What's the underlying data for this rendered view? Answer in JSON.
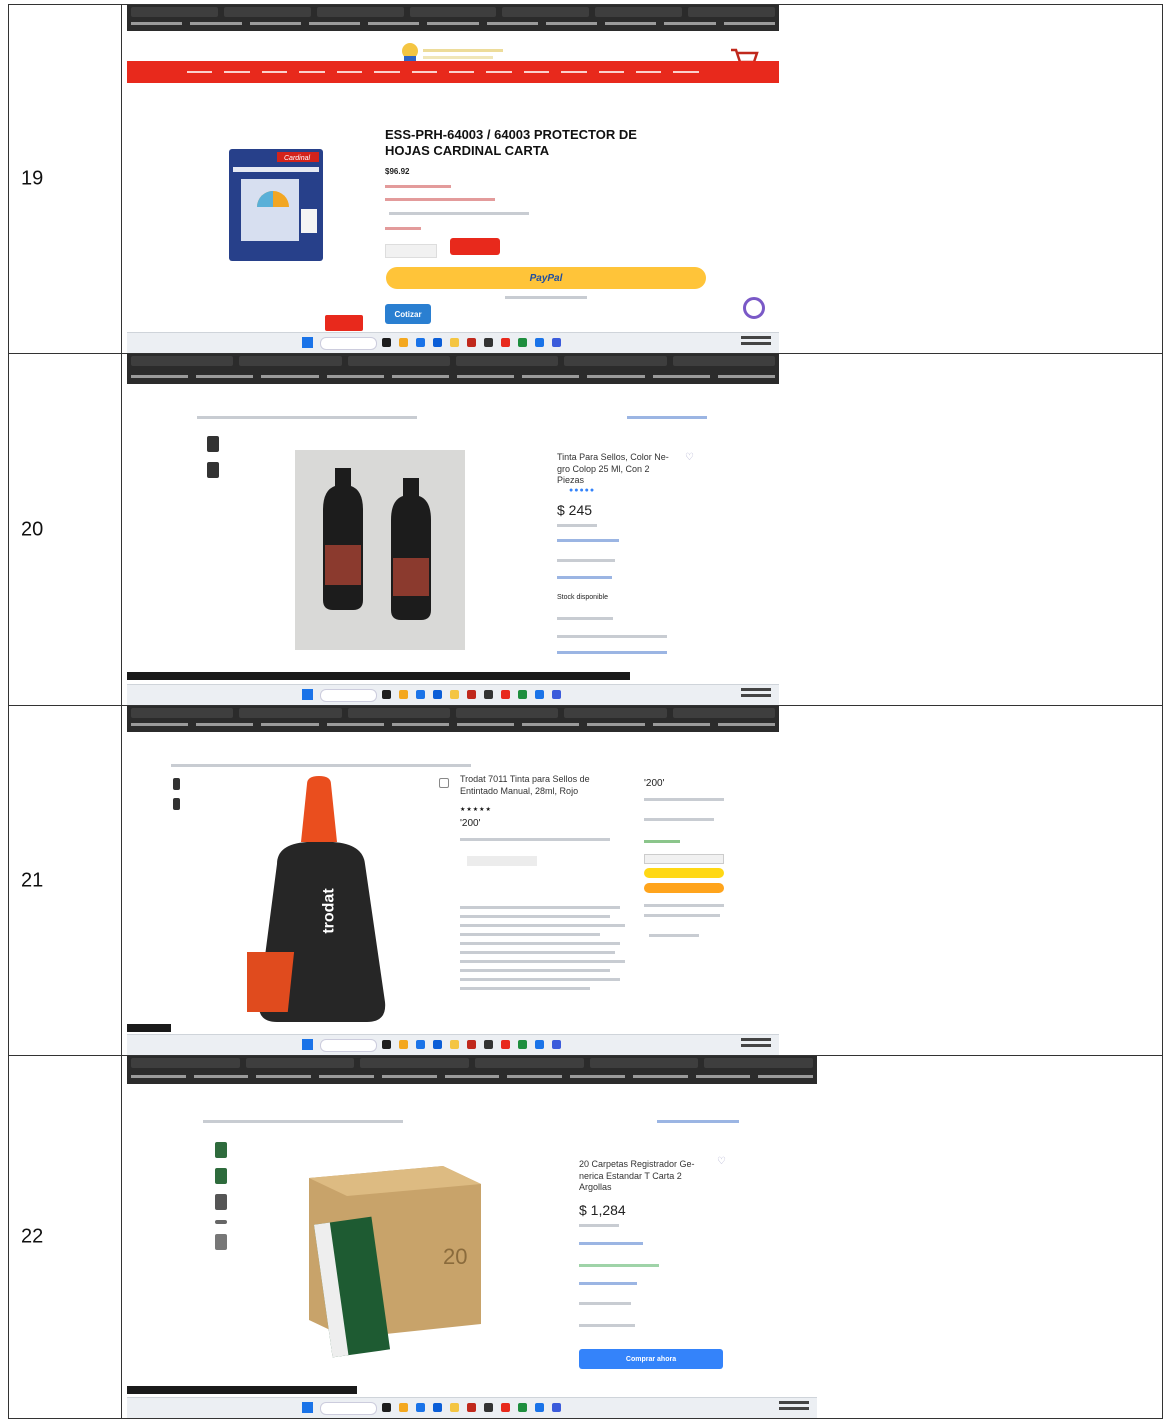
{
  "rows": [
    {
      "number": "19",
      "store": {
        "title_line1": "ESS-PRH-64003 / 64003 PROTECTOR DE",
        "title_line2": "HOJAS CARDINAL CARTA",
        "price": "$96.92",
        "paypal_label": "PayPal",
        "cotizar_label": "Cotizar",
        "package_brand": "Cardinal"
      }
    },
    {
      "number": "20",
      "product": {
        "title_lines": [
          "Tinta Para Sellos, Color Ne-",
          "gro Colop 25 Ml, Con 2",
          "Piezas"
        ],
        "price": "$ 245",
        "stock": "Stock disponible"
      }
    },
    {
      "number": "21",
      "product": {
        "title_line1": "Trodat 7011 Tinta para Sellos de",
        "title_line2": "Entintado Manual, 28ml, Rojo",
        "price": "200",
        "side_price": "200",
        "bottle_brand": "trodat"
      }
    },
    {
      "number": "22",
      "product": {
        "title_lines": [
          "20 Carpetas Registrador Ge-",
          "nerica Estandar T Carta 2",
          "Argollas"
        ],
        "price": "$ 1,284",
        "box_number": "20",
        "buy_button": "Comprar ahora"
      }
    }
  ]
}
